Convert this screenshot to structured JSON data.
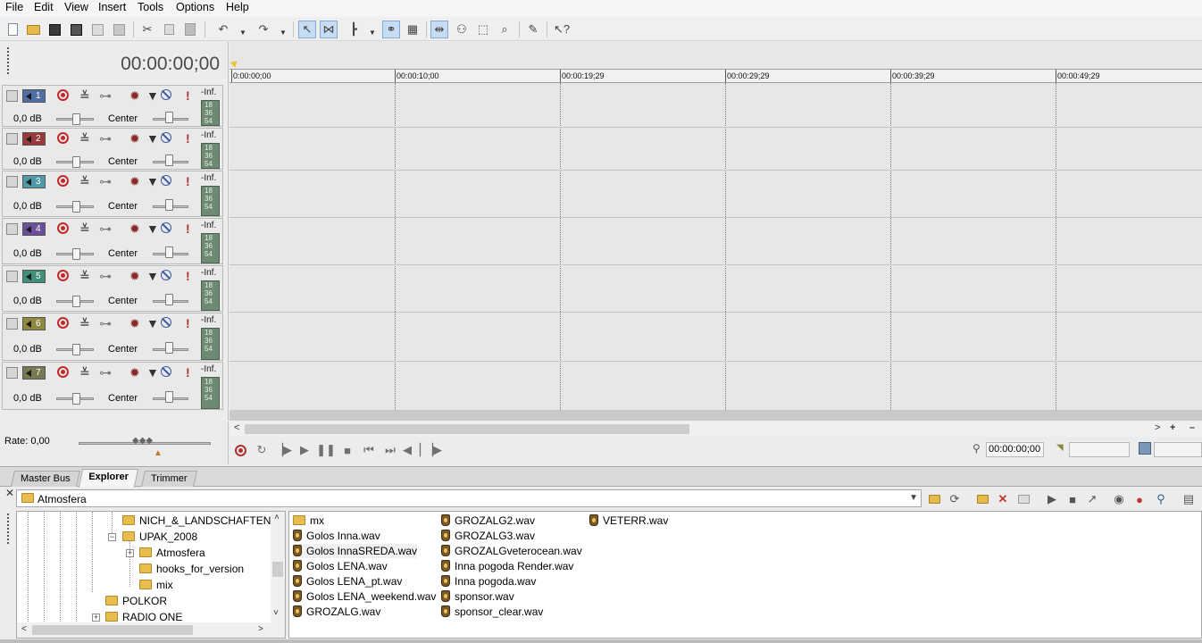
{
  "menu": [
    "File",
    "Edit",
    "View",
    "Insert",
    "Tools",
    "Options",
    "Help"
  ],
  "toolbar": {
    "icons": [
      "new-project-icon",
      "open-icon",
      "save-icon",
      "save-as-icon",
      "render-icon",
      "properties-icon",
      "cut-icon",
      "copy-icon",
      "paste-icon",
      "undo-icon",
      "redo-icon",
      "normal-edit-tool-icon",
      "envelope-tool-icon",
      "snap-icon",
      "lock-envelopes-icon",
      "auto-ripple-icon",
      "selection-tool-icon",
      "zoom-tool-icon",
      "split-tool-icon",
      "erase-tool-icon",
      "help-icon"
    ]
  },
  "time_display": "00:00:00;00",
  "tracks": [
    {
      "number": "1",
      "color": "#4f6ea3",
      "volume": "0,0 dB",
      "pan": "Center",
      "peak": "-Inf.",
      "meter_ticks": [
        "18",
        "36",
        "54"
      ]
    },
    {
      "number": "2",
      "color": "#9a3a3a",
      "volume": "0,0 dB",
      "pan": "Center",
      "peak": "-Inf.",
      "meter_ticks": [
        "18",
        "36",
        "54"
      ]
    },
    {
      "number": "3",
      "color": "#4f9aa8",
      "volume": "0,0 dB",
      "pan": "Center",
      "peak": "-Inf.",
      "meter_ticks": [
        "18",
        "36",
        "54"
      ]
    },
    {
      "number": "4",
      "color": "#6b4f9a",
      "volume": "0,0 dB",
      "pan": "Center",
      "peak": "-Inf.",
      "meter_ticks": [
        "18",
        "36",
        "54"
      ]
    },
    {
      "number": "5",
      "color": "#3f8f7a",
      "volume": "0,0 dB",
      "pan": "Center",
      "peak": "-Inf.",
      "meter_ticks": [
        "18",
        "36",
        "54"
      ]
    },
    {
      "number": "6",
      "color": "#8f8a3f",
      "volume": "0,0 dB",
      "pan": "Center",
      "peak": "-Inf.",
      "meter_ticks": [
        "18",
        "36",
        "54"
      ]
    },
    {
      "number": "7",
      "color": "#7a7a52",
      "volume": "0,0 dB",
      "pan": "Center",
      "peak": "-Inf.",
      "meter_ticks": [
        "18",
        "36",
        "54"
      ]
    }
  ],
  "ruler": [
    "0:00:00;00",
    "00:00:10;00",
    "00:00:19;29",
    "00:00:29;29",
    "00:00:39;29",
    "00:00:49;29"
  ],
  "rate": "Rate: 0,00",
  "transport": {
    "icons": [
      "record-icon",
      "loop-icon",
      "play-from-start-icon",
      "play-icon",
      "pause-icon",
      "stop-icon",
      "go-to-start-icon",
      "go-to-end-icon",
      "previous-frame-icon",
      "next-frame-icon"
    ],
    "cursor_time": "00:00:00;00"
  },
  "dock_tabs": [
    "Master Bus",
    "Explorer",
    "Trimmer"
  ],
  "explorer": {
    "path": "Atmosfera",
    "tree": [
      {
        "label": "NICH_&_LANDSCHAFTEN",
        "level": 2
      },
      {
        "label": "UPAK_2008",
        "level": 2,
        "expanded": true
      },
      {
        "label": "Atmosfera",
        "level": 3,
        "collapsed": true
      },
      {
        "label": "hooks_for_version",
        "level": 3
      },
      {
        "label": "mix",
        "level": 3
      },
      {
        "label": "POLKOR",
        "level": 1
      },
      {
        "label": "RADIO ONE",
        "level": 1,
        "collapsed": true
      }
    ],
    "files_col1": [
      {
        "name": "mx",
        "type": "folder"
      },
      {
        "name": "Golos Inna.wav",
        "type": "wav"
      },
      {
        "name": "Golos InnaSREDA.wav",
        "type": "wav",
        "selected": true
      },
      {
        "name": "Golos LENA.wav",
        "type": "wav"
      },
      {
        "name": "Golos LENA_pt.wav",
        "type": "wav"
      },
      {
        "name": "Golos LENA_weekend.wav",
        "type": "wav"
      },
      {
        "name": "GROZALG.wav",
        "type": "wav"
      }
    ],
    "files_col2": [
      {
        "name": "GROZALG2.wav",
        "type": "wav"
      },
      {
        "name": "GROZALG3.wav",
        "type": "wav"
      },
      {
        "name": "GROZALGveterocean.wav",
        "type": "wav"
      },
      {
        "name": "Inna pogoda Render.wav",
        "type": "wav"
      },
      {
        "name": "Inna pogoda.wav",
        "type": "wav"
      },
      {
        "name": "sponsor.wav",
        "type": "wav"
      },
      {
        "name": "sponsor_clear.wav",
        "type": "wav"
      }
    ],
    "files_col3": [
      {
        "name": "VETERR.wav",
        "type": "wav"
      }
    ]
  }
}
